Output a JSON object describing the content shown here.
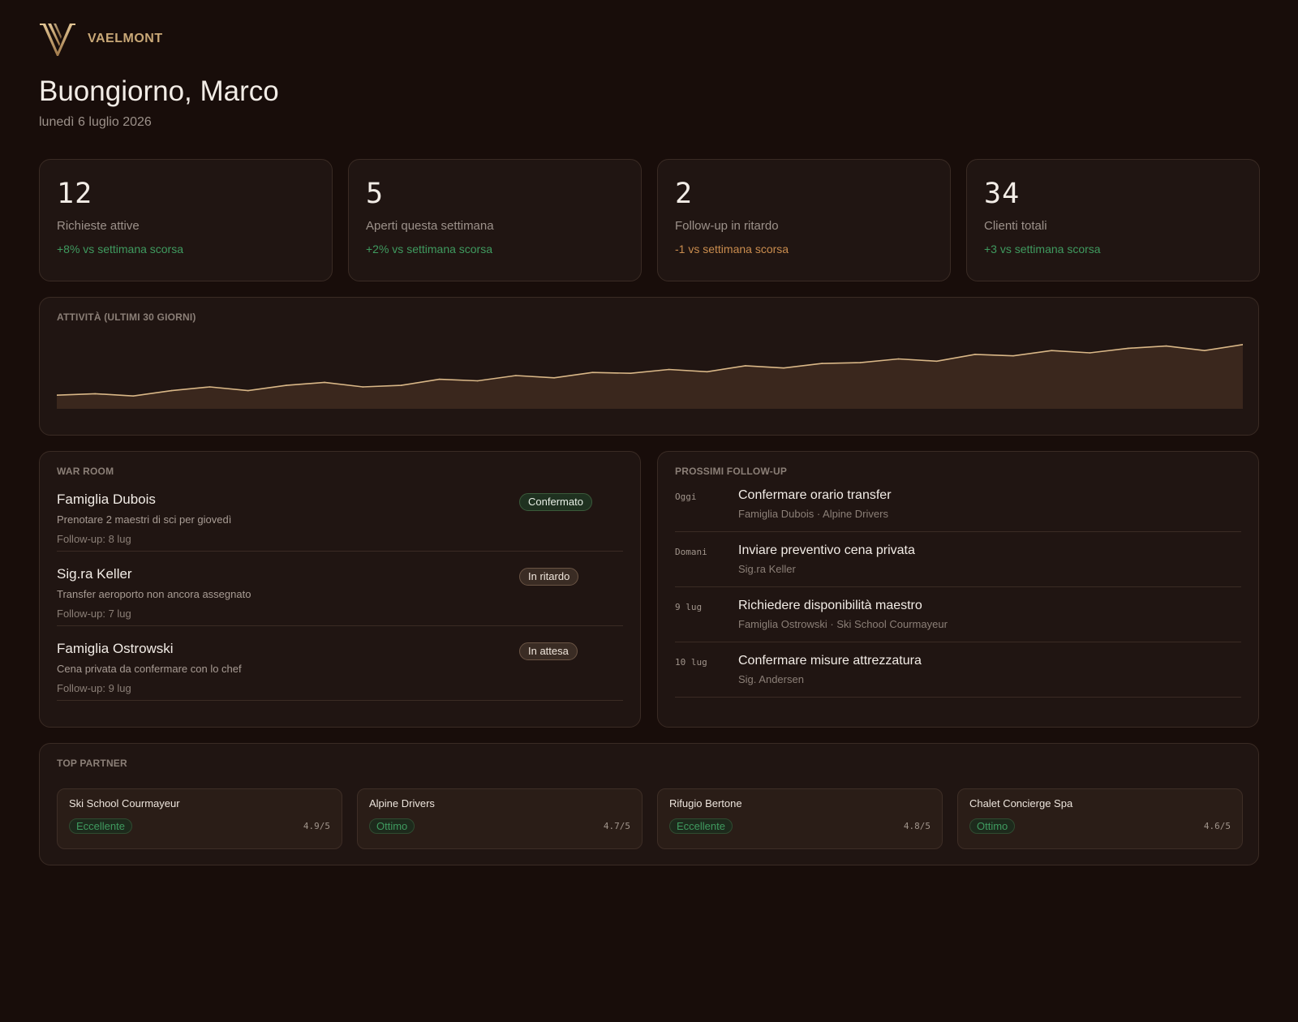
{
  "brand": {
    "name": "VAELMONT",
    "logo_icon": "v-monogram-logo",
    "accent_color": "#c9a877"
  },
  "header": {
    "greeting": "Buongiorno, Marco",
    "date": "lunedì 6 luglio 2026"
  },
  "kpis": [
    {
      "value": "12",
      "label": "Richieste attive",
      "delta": "+8% vs settimana scorsa",
      "tone": "up"
    },
    {
      "value": "5",
      "label": "Aperti questa settimana",
      "delta": "+2% vs settimana scorsa",
      "tone": "up"
    },
    {
      "value": "2",
      "label": "Follow-up in ritardo",
      "delta": "-1 vs settimana scorsa",
      "tone": "warn"
    },
    {
      "value": "34",
      "label": "Clienti totali",
      "delta": "+3 vs settimana scorsa",
      "tone": "up"
    }
  ],
  "activity": {
    "title": "ATTIVITÀ (ULTIMI 30 GIORNI)",
    "line_color": "#d9b787",
    "fill_color": "#3a271d"
  },
  "chart_data": {
    "type": "area",
    "title": "ATTIVITÀ (ULTIMI 30 GIORNI)",
    "values": [
      18,
      20,
      17,
      24,
      29,
      24,
      31,
      35,
      29,
      31,
      39,
      37,
      44,
      41,
      48,
      47,
      52,
      49,
      57,
      54,
      60,
      61,
      66,
      63,
      72,
      70,
      77,
      74,
      80,
      83,
      77,
      85
    ],
    "grid": false,
    "legend": "none"
  },
  "warroom": {
    "title": "WAR ROOM",
    "items": [
      {
        "name": "Famiglia Dubois",
        "desc": "Prenotare 2 maestri di sci per giovedì",
        "followup": "Follow-up: 8 lug",
        "status": "Confermato",
        "status_tone": "green"
      },
      {
        "name": "Sig.ra Keller",
        "desc": "Transfer aeroporto non ancora assegnato",
        "followup": "Follow-up: 7 lug",
        "status": "In ritardo",
        "status_tone": "brown"
      },
      {
        "name": "Famiglia Ostrowski",
        "desc": "Cena privata da confermare con lo chef",
        "followup": "Follow-up: 9 lug",
        "status": "In attesa",
        "status_tone": "brown"
      }
    ]
  },
  "followups": {
    "title": "PROSSIMI FOLLOW-UP",
    "items": [
      {
        "when": "Oggi",
        "title": "Confermare orario transfer",
        "sub": "Famiglia Dubois · Alpine Drivers"
      },
      {
        "when": "Domani",
        "title": "Inviare preventivo cena privata",
        "sub": "Sig.ra Keller"
      },
      {
        "when": "9 lug",
        "title": "Richiedere disponibilità maestro",
        "sub": "Famiglia Ostrowski · Ski School Courmayeur"
      },
      {
        "when": "10 lug",
        "title": "Confermare misure attrezzatura",
        "sub": "Sig. Andersen"
      }
    ]
  },
  "partners": {
    "title": "TOP PARTNER",
    "items": [
      {
        "name": "Ski School Courmayeur",
        "badge": "Eccellente",
        "score": "4.9/5"
      },
      {
        "name": "Alpine Drivers",
        "badge": "Ottimo",
        "score": "4.7/5"
      },
      {
        "name": "Rifugio Bertone",
        "badge": "Eccellente",
        "score": "4.8/5"
      },
      {
        "name": "Chalet Concierge Spa",
        "badge": "Ottimo",
        "score": "4.6/5"
      }
    ]
  }
}
